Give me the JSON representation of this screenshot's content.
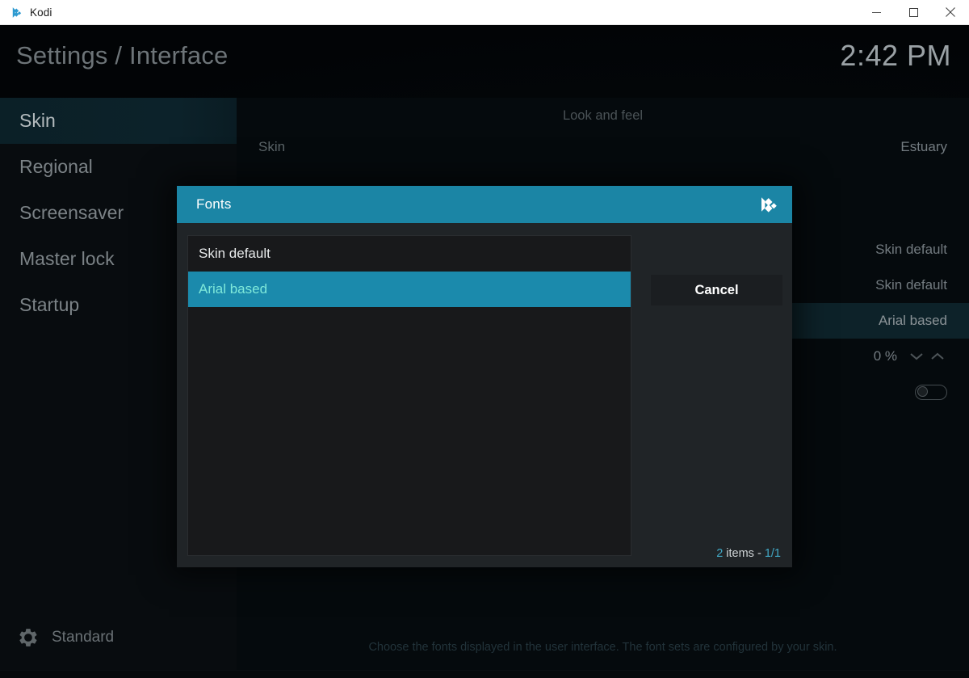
{
  "window": {
    "app_title": "Kodi",
    "logo_icon": "kodi-logo-icon",
    "controls": {
      "minimize": "minimize-icon",
      "maximize": "maximize-icon",
      "close": "close-icon"
    }
  },
  "header": {
    "breadcrumb": "Settings / Interface",
    "clock": "2:42 PM"
  },
  "sidebar": {
    "items": [
      {
        "label": "Skin",
        "selected": true
      },
      {
        "label": "Regional",
        "selected": false
      },
      {
        "label": "Screensaver",
        "selected": false
      },
      {
        "label": "Master lock",
        "selected": false
      },
      {
        "label": "Startup",
        "selected": false
      }
    ],
    "level_button": {
      "label": "Standard",
      "icon": "gear-icon"
    }
  },
  "settings": {
    "section_title": "Look and feel",
    "rows": [
      {
        "label": "Skin",
        "value": "Estuary",
        "type": "select",
        "highlighted": false
      },
      {
        "label": "",
        "value": "",
        "type": "blank",
        "highlighted": false
      },
      {
        "label": "",
        "value": "Skin default",
        "type": "select",
        "highlighted": false
      },
      {
        "label": "",
        "value": "Skin default",
        "type": "select",
        "highlighted": false
      },
      {
        "label": "",
        "value": "Arial based",
        "type": "select",
        "highlighted": true
      },
      {
        "label": "",
        "value": "0 %",
        "type": "spinner",
        "highlighted": false
      },
      {
        "label": "",
        "value": "",
        "type": "toggle",
        "toggle_on": false,
        "highlighted": false
      }
    ],
    "description": "Choose the fonts displayed in the user interface. The font sets are configured by your skin."
  },
  "dialog": {
    "title": "Fonts",
    "logo_icon": "kodi-logo-icon",
    "options": [
      {
        "label": "Skin default",
        "selected": false
      },
      {
        "label": "Arial based",
        "selected": true
      }
    ],
    "cancel_label": "Cancel",
    "footer": {
      "count": "2",
      "middle": " items - ",
      "page": "1/1"
    }
  },
  "colors": {
    "accent_teal": "#1b85a5",
    "selected_text": "#7fe9da",
    "dialog_bg": "#202427",
    "list_bg": "#18191b",
    "app_bg": "#05080a"
  }
}
